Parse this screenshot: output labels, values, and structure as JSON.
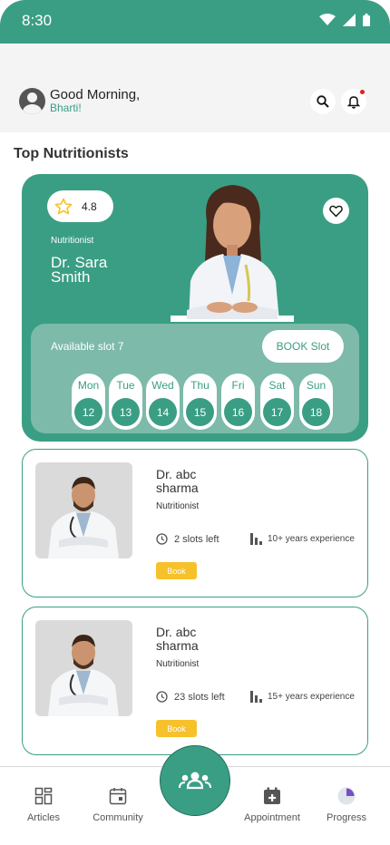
{
  "status": {
    "time": "8:30"
  },
  "header": {
    "greeting": "Good Morning,",
    "user": "Bharti!"
  },
  "section_title": "Top Nutritionists",
  "featured": {
    "rating": "4.8",
    "role": "Nutritionist",
    "name": "Dr. Sara Smith",
    "slot_label": "Available slot 7",
    "book_label": "BOOK Slot",
    "days": [
      {
        "name": "Mon",
        "num": "12"
      },
      {
        "name": "Tue",
        "num": "13"
      },
      {
        "name": "Wed",
        "num": "14"
      },
      {
        "name": "Thu",
        "num": "15"
      },
      {
        "name": "Fri",
        "num": "16"
      },
      {
        "name": "Sat",
        "num": "17"
      },
      {
        "name": "Sun",
        "num": "18"
      }
    ]
  },
  "doctors": [
    {
      "name": "Dr. abc sharma",
      "role": "Nutritionist",
      "slots": "2 slots  left",
      "experience": "10+ years experience",
      "book": "Book"
    },
    {
      "name": "Dr. abc sharma",
      "role": "Nutritionist",
      "slots": "23 slots  left",
      "experience": "15+ years experience",
      "book": "Book"
    }
  ],
  "nav": {
    "articles": "Articles",
    "community": "Community",
    "appointment": "Appointment",
    "progress": "Progress"
  },
  "colors": {
    "primary": "#3a9e84",
    "accent": "#f7c12c",
    "panel": "#7dbaa9"
  }
}
